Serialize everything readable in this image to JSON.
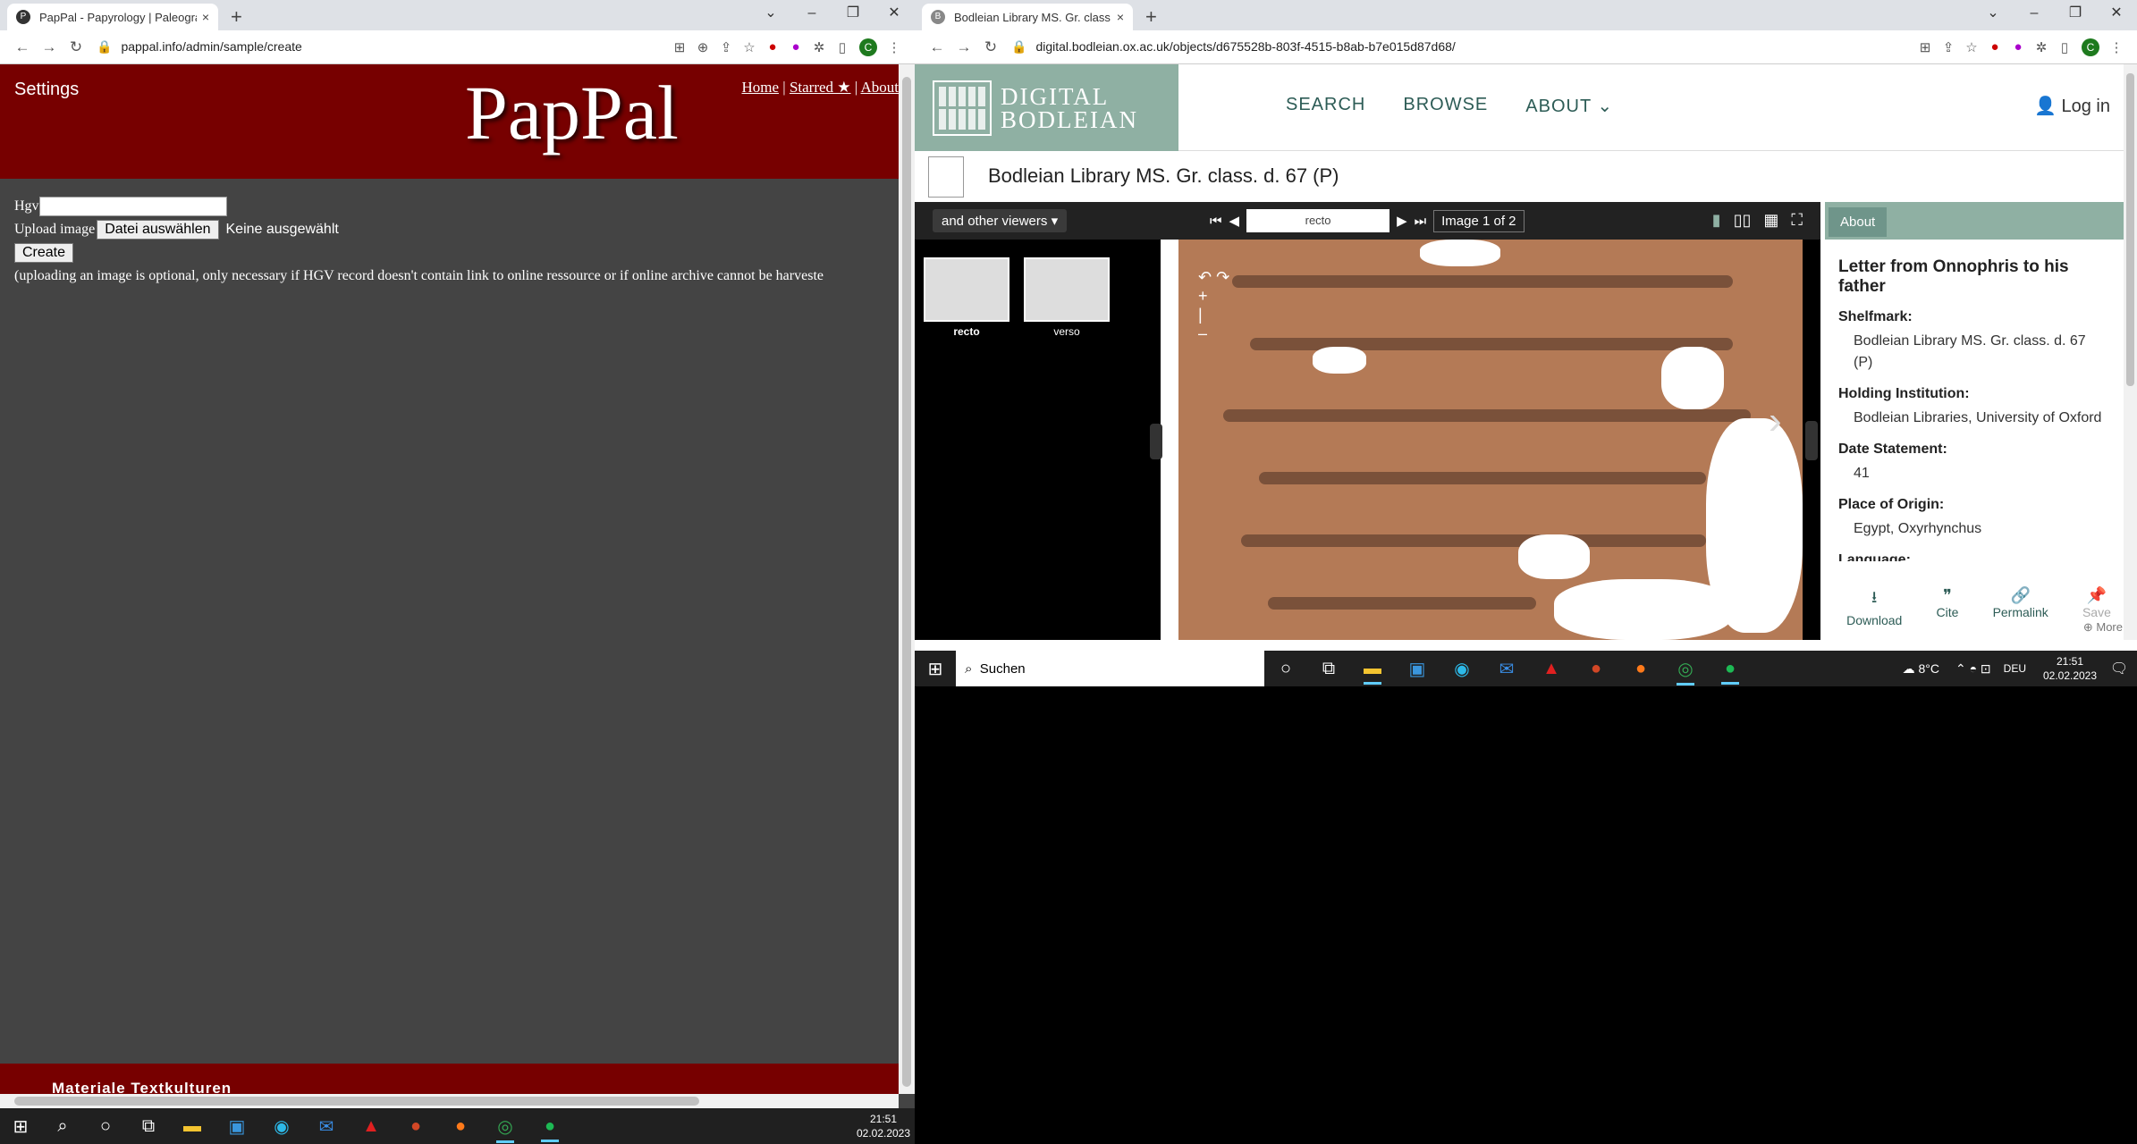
{
  "left": {
    "tab": {
      "title": "PapPal - Papyrology | Paleograph",
      "close": "×"
    },
    "newtab": "+",
    "url": "pappal.info/admin/sample/create",
    "settings": "Settings",
    "logo": "PapPal",
    "nav": {
      "home": "Home",
      "starred": "Starred ★",
      "about": "About",
      "sep": "|"
    },
    "form": {
      "hgv_label": "Hgv",
      "upload_label": "Upload image",
      "choose_button": "Datei auswählen",
      "no_file": "Keine ausgewählt",
      "create_button": "Create",
      "note": "(uploading an image is optional, only necessary if HGV record doesn't contain link to online ressource or if online archive cannot be harveste"
    },
    "footer": "Materiale Textkulturen"
  },
  "right": {
    "tab": {
      "title": "Bodleian Library MS. Gr. class. d",
      "close": "×"
    },
    "newtab": "+",
    "url": "digital.bodleian.ox.ac.uk/objects/d675528b-803f-4515-b8ab-b7e015d87d68/",
    "logo_line1": "DIGITAL",
    "logo_line2": "BODLEIAN",
    "nav": [
      "SEARCH",
      "BROWSE",
      "ABOUT ⌄"
    ],
    "login": "Log in",
    "title": "Bodleian Library MS. Gr. class. d. 67 (P)",
    "viewer": {
      "viewers_label": "and other viewers ▾",
      "page_value": "recto",
      "image_of": "Image 1 of 2",
      "thumbs": [
        "recto",
        "verso"
      ]
    },
    "sidebar": {
      "tab": "About",
      "heading": "Letter from Onnophris to his father",
      "fields": [
        {
          "label": "Shelfmark:",
          "value": "Bodleian Library MS. Gr. class. d. 67 (P)"
        },
        {
          "label": "Holding Institution:",
          "value": "Bodleian Libraries, University of Oxford"
        },
        {
          "label": "Date Statement:",
          "value": "41"
        },
        {
          "label": "Place of Origin:",
          "value": "Egypt, Oxyrhynchus"
        },
        {
          "label": "Language:",
          "value": ""
        }
      ],
      "actions": [
        {
          "icon": "⭳",
          "label": "Download"
        },
        {
          "icon": "❞",
          "label": "Cite"
        },
        {
          "icon": "🔗",
          "label": "Permalink"
        },
        {
          "icon": "📌",
          "label": "Save"
        }
      ],
      "more": "More"
    },
    "taskbar": {
      "search": "Suchen",
      "temp": "8°C",
      "lang": "DEU",
      "time": "21:51",
      "date": "02.02.2023"
    }
  },
  "taskbar": {
    "time": "21:51",
    "date": "02.02.2023"
  },
  "colors": {
    "pappal_red": "#770000",
    "bodleian_green": "#8fb0a3"
  }
}
